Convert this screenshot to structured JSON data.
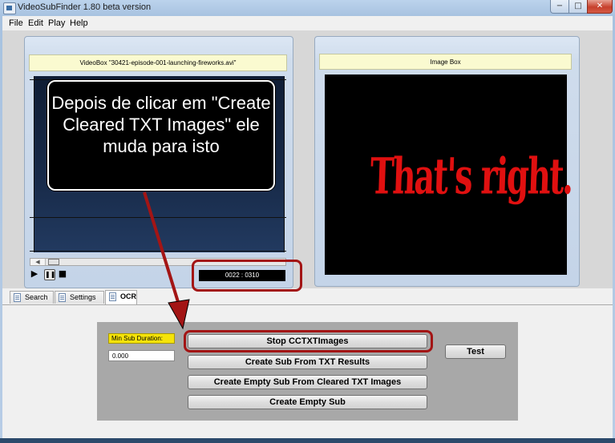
{
  "window": {
    "title": "VideoSubFinder 1.80 beta version",
    "min_label": "−",
    "max_label": "□",
    "close_label": "✕"
  },
  "menu": {
    "items": [
      "File",
      "Edit",
      "Play",
      "Help"
    ]
  },
  "video_box": {
    "title": "VideoBox \"30421-episode-001-launching-fireworks.avi\"",
    "time": "0022 : 0310",
    "controls": {
      "play": "▶",
      "pause": "❚❚",
      "stop": "■"
    },
    "scroll_left": "◀"
  },
  "image_box": {
    "title": "Image Box",
    "image_text": "That's right."
  },
  "tabs": [
    "Search",
    "Settings",
    "OCR"
  ],
  "ocr": {
    "min_sub_duration_label": "Min Sub Duration:",
    "min_sub_duration_value": "0.000",
    "buttons": {
      "stop_cctx": "Stop CCTXTImages",
      "create_sub_txt": "Create Sub From TXT Results",
      "create_empty_cleared": "Create Empty Sub From Cleared TXT Images",
      "create_empty": "Create Empty Sub",
      "test": "Test"
    }
  },
  "annotation": {
    "callout_text": "Depois de clicar em \"Create Cleared TXT Images\" ele muda para isto",
    "color": "#a31515"
  }
}
